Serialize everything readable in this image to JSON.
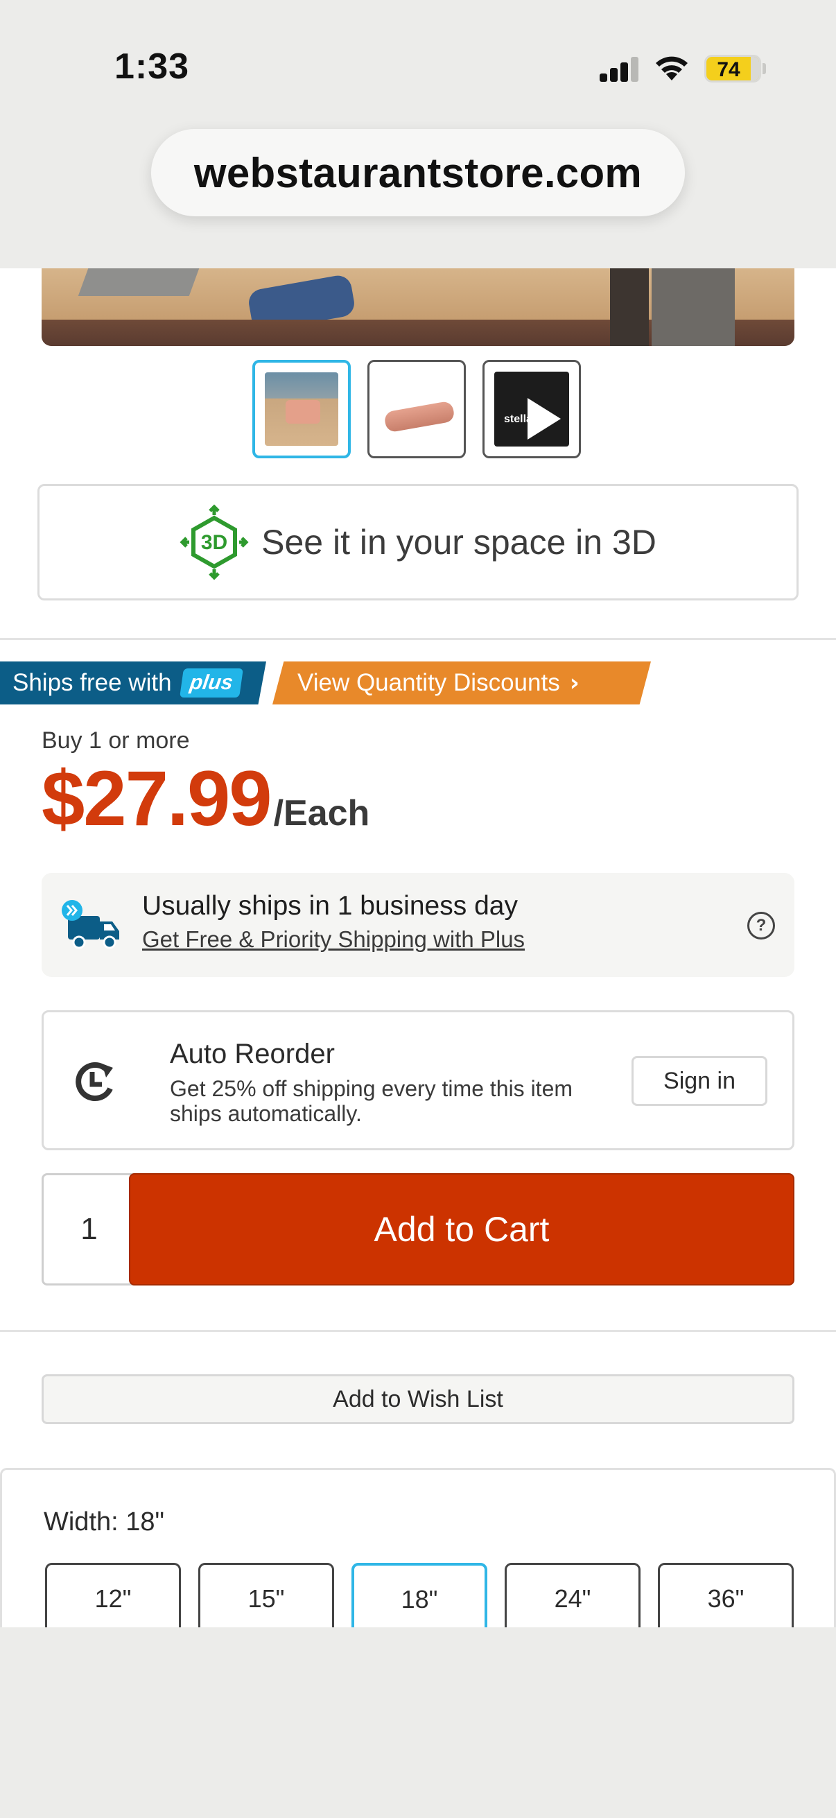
{
  "status_bar": {
    "time": "1:33",
    "battery": "74"
  },
  "browser": {
    "url": "webstaurantstore.com"
  },
  "gallery": {
    "thumbnails": [
      {
        "kind": "photo",
        "selected": true
      },
      {
        "kind": "product-roll",
        "selected": false
      },
      {
        "kind": "video",
        "selected": false,
        "overlay_text": "stella"
      }
    ]
  },
  "view_3d": {
    "label": "See it in your space in 3D",
    "icon_text": "3D",
    "icon": "ar-3d-icon",
    "color": "#2e9a2e"
  },
  "badges": {
    "ships_free_text": "Ships free with",
    "plus_label": "plus",
    "discounts_label": "View Quantity Discounts",
    "ships_free_color": "#0c5d87",
    "discounts_color": "#e8892a"
  },
  "pricing": {
    "buy_label": "Buy 1 or more",
    "price": "$27.99",
    "unit": "/Each",
    "price_color": "#d23b0c"
  },
  "shipping": {
    "title": "Usually ships in 1 business day",
    "link": "Get Free & Priority Shipping with Plus",
    "icon": "truck-icon",
    "help_symbol": "?"
  },
  "auto_reorder": {
    "title": "Auto Reorder",
    "description": "Get 25% off shipping every time this item ships automatically.",
    "signin_label": "Sign in"
  },
  "cart": {
    "quantity": "1",
    "add_label": "Add to Cart",
    "button_color": "#cc3300"
  },
  "wishlist": {
    "label": "Add to Wish List"
  },
  "width_selector": {
    "label": "Width:",
    "value": "18\"",
    "options": [
      "12\"",
      "15\"",
      "18\"",
      "24\"",
      "36\""
    ],
    "selected": "18\""
  }
}
